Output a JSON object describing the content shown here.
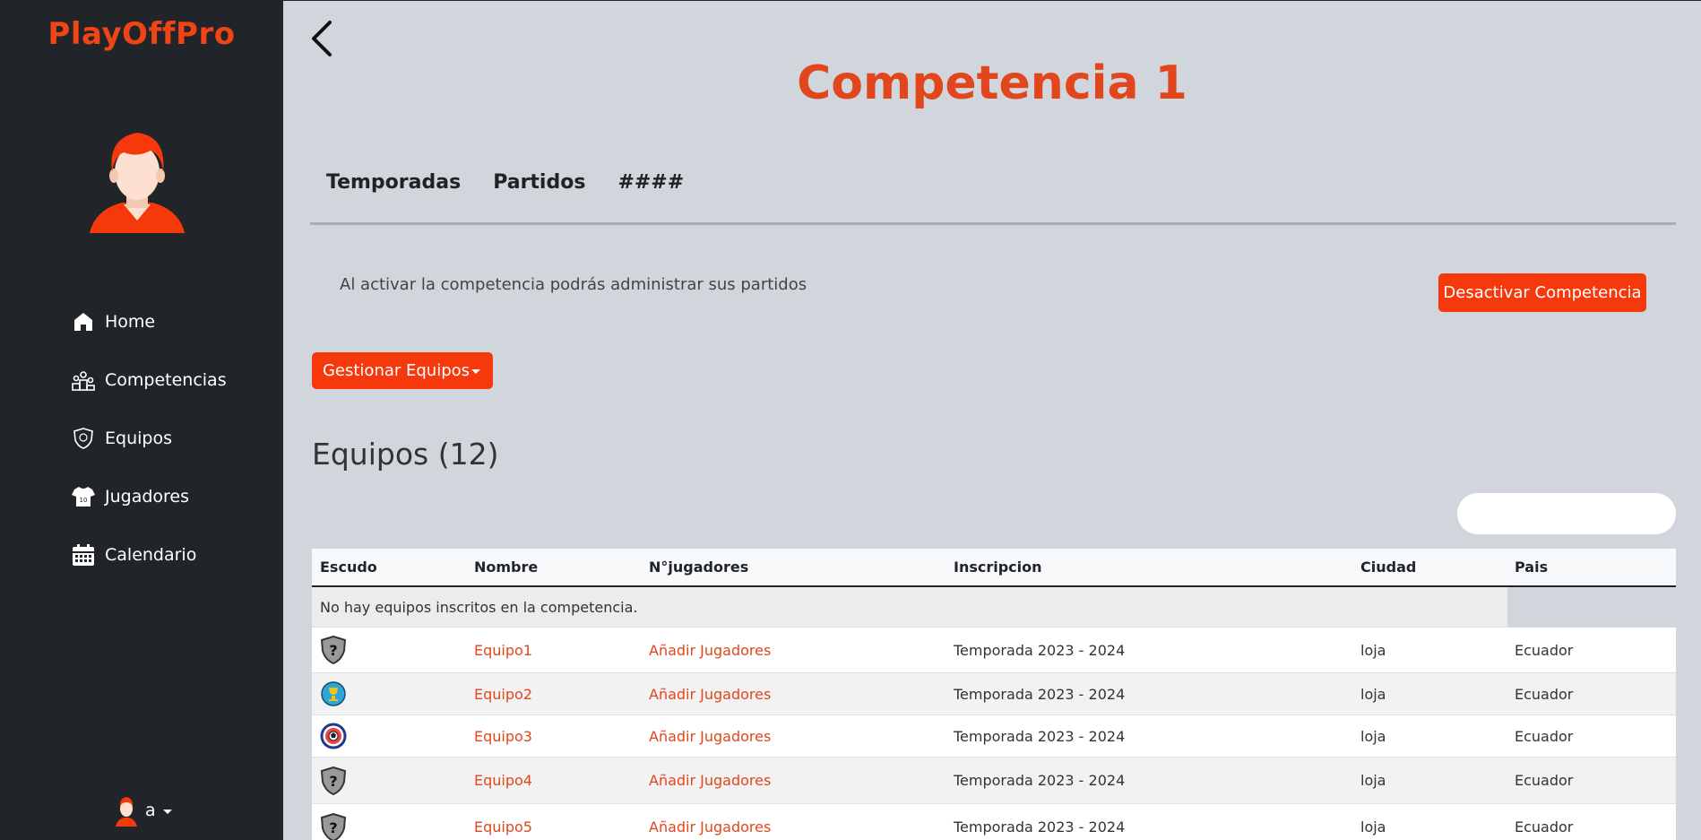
{
  "sidebar": {
    "brand": "PlayOffPro",
    "items": [
      {
        "label": "Home",
        "icon": "home-icon"
      },
      {
        "label": "Competencias",
        "icon": "podium-icon"
      },
      {
        "label": "Equipos",
        "icon": "shield-icon"
      },
      {
        "label": "Jugadores",
        "icon": "jersey-icon"
      },
      {
        "label": "Calendario",
        "icon": "calendar-icon"
      }
    ],
    "user": {
      "name": "a"
    }
  },
  "header": {
    "title": "Competencia 1"
  },
  "tabs": [
    {
      "label": "Temporadas"
    },
    {
      "label": "Partidos"
    },
    {
      "label": "####"
    }
  ],
  "info_text": "Al activar la competencia podrás administrar sus partidos",
  "buttons": {
    "deactivate": "Desactivar Competencia",
    "manage_teams": "Gestionar Equipos"
  },
  "teams_section": {
    "title": "Equipos (12)",
    "search_placeholder": ""
  },
  "table": {
    "headers": [
      "Escudo",
      "Nombre",
      "N°jugadores",
      "Inscripcion",
      "Ciudad",
      "Pais"
    ],
    "empty_message": "No hay equipos inscritos en la competencia.",
    "rows": [
      {
        "crest": "unknown-shield",
        "name": "Equipo1",
        "players": "Añadir Jugadores",
        "season": "Temporada 2023 - 2024",
        "city": "loja",
        "country": "Ecuador"
      },
      {
        "crest": "trophy-badge",
        "name": "Equipo2",
        "players": "Añadir Jugadores",
        "season": "Temporada 2023 - 2024",
        "city": "loja",
        "country": "Ecuador"
      },
      {
        "crest": "ball-badge",
        "name": "Equipo3",
        "players": "Añadir Jugadores",
        "season": "Temporada 2023 - 2024",
        "city": "loja",
        "country": "Ecuador"
      },
      {
        "crest": "unknown-shield",
        "name": "Equipo4",
        "players": "Añadir Jugadores",
        "season": "Temporada 2023 - 2024",
        "city": "loja",
        "country": "Ecuador"
      },
      {
        "crest": "unknown-shield",
        "name": "Equipo5",
        "players": "Añadir Jugadores",
        "season": "Temporada 2023 - 2024",
        "city": "loja",
        "country": "Ecuador"
      }
    ]
  },
  "colors": {
    "accent": "#f5390c",
    "title": "#e2461c",
    "sidebar_bg": "#212529",
    "main_bg": "#d1d5dc"
  }
}
